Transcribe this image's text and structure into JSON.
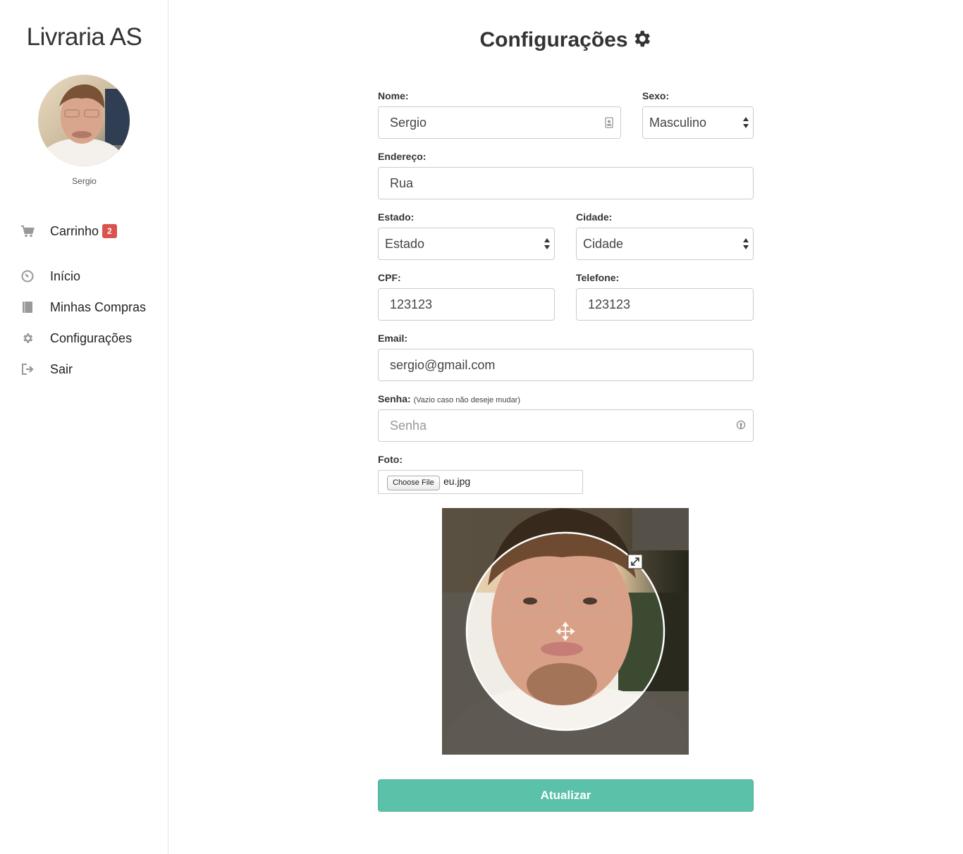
{
  "sidebar": {
    "brand": "Livraria AS",
    "user_name": "Sergio",
    "items": [
      {
        "label": "Carrinho",
        "badge": "2",
        "icon": "cart-icon"
      },
      {
        "label": "Início",
        "icon": "dashboard-icon"
      },
      {
        "label": "Minhas Compras",
        "icon": "book-icon"
      },
      {
        "label": "Configurações",
        "icon": "gear-icon"
      },
      {
        "label": "Sair",
        "icon": "sign-out-icon"
      }
    ]
  },
  "page": {
    "title": "Configurações",
    "title_icon": "gear-icon"
  },
  "form": {
    "nome": {
      "label": "Nome:",
      "value": "Sergio"
    },
    "sexo": {
      "label": "Sexo:",
      "value": "Masculino"
    },
    "endereco": {
      "label": "Endereço:",
      "value": "Rua"
    },
    "estado": {
      "label": "Estado:",
      "value": "Estado"
    },
    "cidade": {
      "label": "Cidade:",
      "value": "Cidade"
    },
    "cpf": {
      "label": "CPF:",
      "value": "123123"
    },
    "telefone": {
      "label": "Telefone:",
      "value": "123123"
    },
    "email": {
      "label": "Email:",
      "value": "sergio@gmail.com"
    },
    "senha": {
      "label": "Senha:",
      "hint": "(Vazio caso não deseje mudar)",
      "placeholder": "Senha"
    },
    "foto": {
      "label": "Foto:",
      "button": "Choose File",
      "file_name": "eu.jpg"
    },
    "submit_label": "Atualizar"
  },
  "colors": {
    "accent": "#5bc1a9",
    "badge": "#d9534f"
  }
}
